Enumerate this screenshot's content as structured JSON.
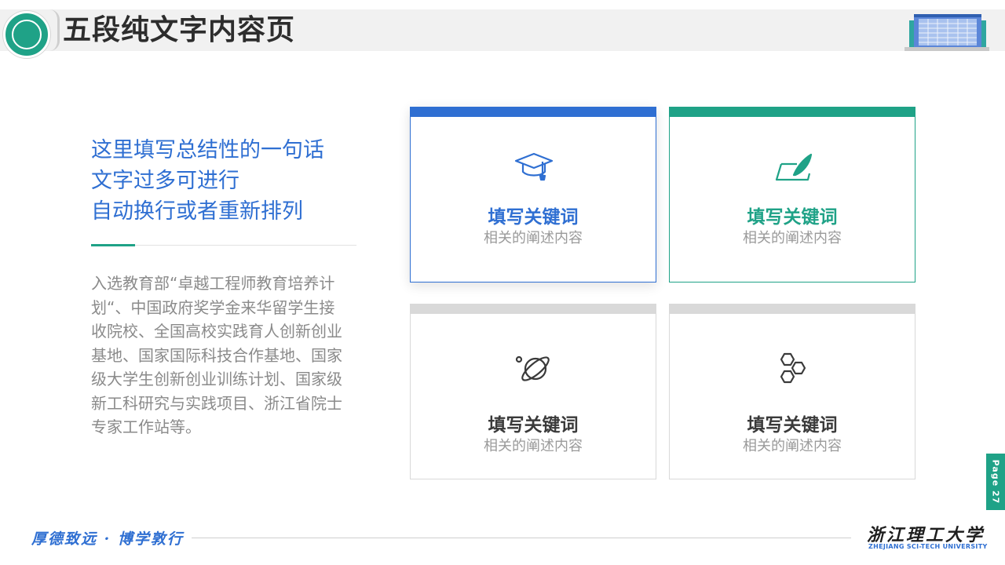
{
  "header": {
    "title": "五段纯文字内容页"
  },
  "left": {
    "summary_lines": [
      "这里填写总结性的一句话",
      "文字过多可进行",
      "自动换行或者重新排列"
    ],
    "body": "入选教育部“卓越工程师教育培养计划“、中国政府奖学金来华留学生接收院校、全国高校实践育人创新创业基地、国家国际科技合作基地、国家级大学生创新创业训练计划、国家级新工科研究与实践项目、浙江省院士专家工作站等。"
  },
  "cards": [
    {
      "icon": "graduation-cap-icon",
      "keyword": "填写关键词",
      "description": "相关的阐述内容",
      "accent": "#2f6fd2"
    },
    {
      "icon": "feather-pen-icon",
      "keyword": "填写关键词",
      "description": "相关的阐述内容",
      "accent": "#1fa287"
    },
    {
      "icon": "planet-icon",
      "keyword": "填写关键词",
      "description": "相关的阐述内容",
      "accent": "#d9d9d9"
    },
    {
      "icon": "hexagons-icon",
      "keyword": "填写关键词",
      "description": "相关的阐述内容",
      "accent": "#d9d9d9"
    }
  ],
  "page_tab": "Page 27",
  "footer": {
    "motto": "厚德致远 · 博学敦行",
    "university_cn": "浙江理工大学",
    "university_en": "ZHEJIANG SCI-TECH UNIVERSITY"
  },
  "colors": {
    "blue": "#2f6fd2",
    "green": "#1fa287",
    "gray": "#d9d9d9"
  }
}
